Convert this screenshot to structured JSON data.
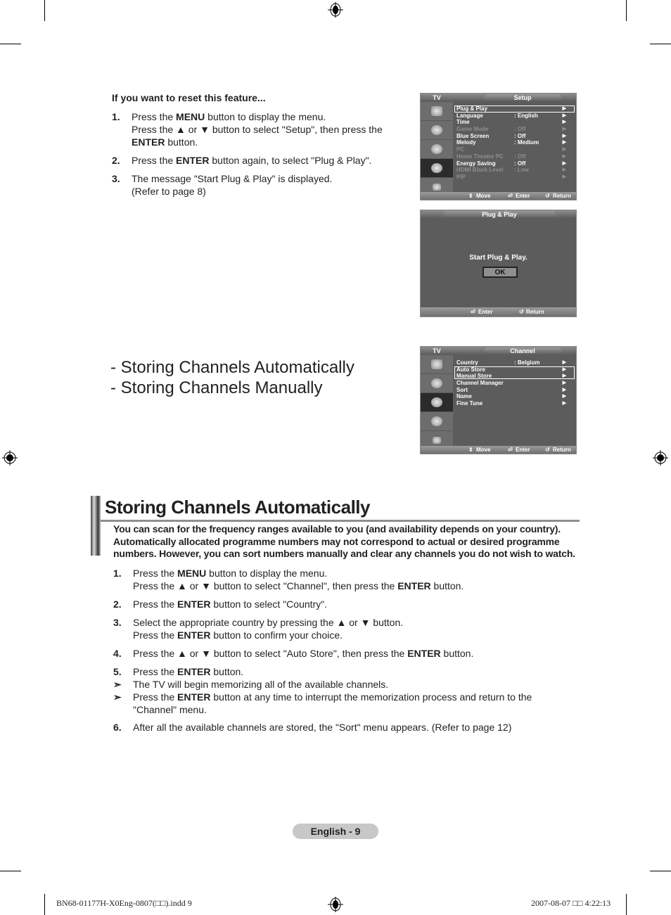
{
  "reset_section": {
    "title": "If you want to reset this feature...",
    "steps": [
      {
        "num": "1.",
        "line1_pre": "Press the ",
        "line1_bold": "MENU",
        "line1_post": " button to display the menu.",
        "line2": "Press the ▲ or ▼ button to select \"Setup\", then press the",
        "line3_bold": "ENTER",
        "line3_post": " button."
      },
      {
        "num": "2.",
        "pre": "Press the ",
        "bold": "ENTER",
        "post": " button again, to select \"Plug & Play\"."
      },
      {
        "num": "3.",
        "line1": "The message \"Start Plug & Play\" is displayed.",
        "line2": "(Refer to page 8)"
      }
    ]
  },
  "setup_menu": {
    "tv_label": "TV",
    "title": "Setup",
    "items": [
      {
        "label": "Plug & Play",
        "value": "",
        "dim": false,
        "selected": true
      },
      {
        "label": "Language",
        "value": ": English",
        "dim": false
      },
      {
        "label": "Time",
        "value": "",
        "dim": false
      },
      {
        "label": "Game Mode",
        "value": ": Off",
        "dim": true
      },
      {
        "label": "Blue Screen",
        "value": ": Off",
        "dim": false
      },
      {
        "label": "Melody",
        "value": ": Medium",
        "dim": false
      },
      {
        "label": "PC",
        "value": "",
        "dim": true
      },
      {
        "label": "Home Theatre PC",
        "value": ": Off",
        "dim": true
      },
      {
        "label": "Energy Saving",
        "value": ": Off",
        "dim": false
      },
      {
        "label": "HDMI Black Level",
        "value": ": Low",
        "dim": true
      },
      {
        "label": "PIP",
        "value": "",
        "dim": true
      }
    ],
    "footer": {
      "move": "Move",
      "enter": "Enter",
      "return": "Return"
    }
  },
  "plug_play_dialog": {
    "title": "Plug & Play",
    "message": "Start Plug & Play.",
    "ok_label": "OK",
    "footer": {
      "enter": "Enter",
      "return": "Return"
    }
  },
  "links": [
    "- Storing Channels Automatically",
    "- Storing Channels Manually"
  ],
  "channel_menu": {
    "tv_label": "TV",
    "title": "Channel",
    "items": [
      {
        "label": "Country",
        "value": ":  Belgium"
      },
      {
        "label": "Auto Store",
        "value": ""
      },
      {
        "label": "Manual Store",
        "value": ""
      },
      {
        "label": "Channel Manager",
        "value": ""
      },
      {
        "label": "Sort",
        "value": ""
      },
      {
        "label": "Name",
        "value": ""
      },
      {
        "label": "Fine Tune",
        "value": ""
      }
    ],
    "footer": {
      "move": "Move",
      "enter": "Enter",
      "return": "Return"
    }
  },
  "auto_section": {
    "title": "Storing Channels Automatically",
    "intro": "You can scan for the frequency ranges available to you (and availability depends on your country). Automatically allocated programme numbers may not correspond to actual or desired programme numbers. However, you can sort numbers manually and clear any channels you do not wish to watch.",
    "steps": {
      "s1": {
        "num": "1.",
        "a": "Press the ",
        "b": "MENU",
        "c": " button to display the menu.",
        "d": "Press the ▲ or ▼ button to select \"Channel\", then press the ",
        "e": "ENTER",
        "f": " button."
      },
      "s2": {
        "num": "2.",
        "a": "Press the ",
        "b": "ENTER",
        "c": " button to select \"Country\"."
      },
      "s3": {
        "num": "3.",
        "a": "Select the appropriate country by pressing the ▲ or ▼ button.",
        "b": "Press the ",
        "c": "ENTER",
        "d": " button to confirm your choice."
      },
      "s4": {
        "num": "4.",
        "a": "Press the ▲ or ▼ button to select \"Auto Store\", then press the ",
        "b": "ENTER",
        "c": " button."
      },
      "s5": {
        "num": "5.",
        "a": "Press the ",
        "b": "ENTER",
        "c": " button."
      },
      "note1": {
        "mark": "➣",
        "text": "The TV will begin memorizing all of the available channels."
      },
      "note2": {
        "mark": "➣",
        "a": "Press the ",
        "b": "ENTER",
        "c": " button at any time to interrupt the memorization process and return to the",
        "d": "\"Channel\" menu."
      },
      "s6": {
        "num": "6.",
        "a": "After all the available channels are stored, the \"Sort\" menu appears. (Refer to page 12)"
      }
    }
  },
  "footer": {
    "page_label": "English - 9",
    "slug_left": "BN68-01177H-X0Eng-0807(□□).indd   9",
    "slug_right": "2007-08-07   □□ 4:22:13"
  }
}
